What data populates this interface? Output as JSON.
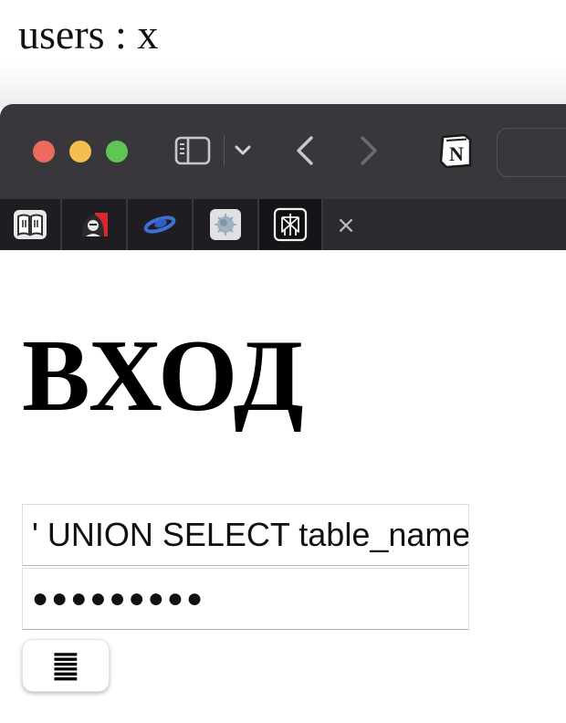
{
  "caption": {
    "text": "users : x"
  },
  "toolbar": {
    "traffic_lights": {
      "close": "#ed6a5e",
      "minimize": "#f5bf4f",
      "zoom": "#61c554"
    },
    "icons": [
      "sidebar-icon",
      "chevron-down-icon",
      "back-icon",
      "forward-icon",
      "notion-icon"
    ],
    "notion_letter": "N"
  },
  "tabs": {
    "items": [
      {
        "icon": "book-icon"
      },
      {
        "icon": "hacker-avatar-icon"
      },
      {
        "icon": "saturn-logo-icon"
      },
      {
        "icon": "spiky-ball-icon"
      },
      {
        "icon": "perplexity-icon"
      }
    ],
    "close_glyph": "×"
  },
  "page": {
    "title": "ВХОД",
    "login_value": "' UNION SELECT table_name FROM information_schema.tables --",
    "password_value": "●●●●●●●●●",
    "submit_glyph": "䷀"
  }
}
